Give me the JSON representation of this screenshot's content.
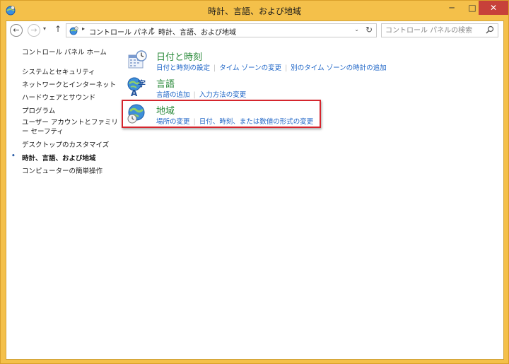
{
  "window": {
    "title": "時計、言語、および地域",
    "minimize": "─",
    "maximize": "□",
    "close": "✕"
  },
  "nav": {
    "back": "←",
    "forward": "→",
    "recent": "▾",
    "up": "↑"
  },
  "address": {
    "crumbs": [
      "コントロール パネル",
      "時計、言語、および地域"
    ],
    "separator": "▸",
    "dropdown": "⌄",
    "refresh": "↻"
  },
  "search": {
    "placeholder": "コントロール パネルの検索"
  },
  "sidebar": {
    "items": [
      {
        "label": "コントロール パネル ホーム"
      },
      {
        "label": "システムとセキュリティ"
      },
      {
        "label": "ネットワークとインターネット"
      },
      {
        "label": "ハードウェアとサウンド"
      },
      {
        "label": "プログラム"
      },
      {
        "label": "ユーザー アカウントとファミリー セーフティ"
      },
      {
        "label": "デスクトップのカスタマイズ"
      },
      {
        "label": "時計、言語、および地域"
      },
      {
        "label": "コンピューターの簡単操作"
      }
    ],
    "current_marker": "•"
  },
  "categories": [
    {
      "title": "日付と時刻",
      "icon": "calendar-clock-icon",
      "links": [
        "日付と時刻の設定",
        "タイム ゾーンの変更",
        "別のタイム ゾーンの時計の追加"
      ]
    },
    {
      "title": "言語",
      "icon": "language-icon",
      "links": [
        "言語の追加",
        "入力方法の変更"
      ]
    },
    {
      "title": "地域",
      "icon": "globe-clock-icon",
      "links": [
        "場所の変更",
        "日付、時刻、または数値の形式の変更"
      ]
    }
  ],
  "colors": {
    "title_bar": "#f4c04a",
    "close_button": "#c7413a",
    "category_title": "#2a8a3a",
    "link": "#1f66c7",
    "highlight_border": "#d5252d"
  }
}
